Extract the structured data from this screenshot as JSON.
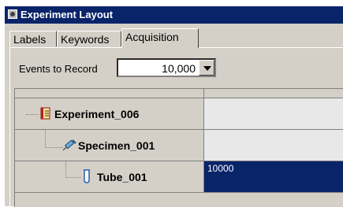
{
  "window": {
    "title": "Experiment Layout"
  },
  "tabs": [
    {
      "label": "Labels",
      "active": false
    },
    {
      "label": "Keywords",
      "active": false
    },
    {
      "label": "Acquisition",
      "active": true
    }
  ],
  "events": {
    "label": "Events to Record",
    "value": "10,000"
  },
  "tree": [
    {
      "name": "Experiment_006",
      "icon": "experiment-book-icon",
      "value": ""
    },
    {
      "name": "Specimen_001",
      "icon": "syringe-icon",
      "value": ""
    },
    {
      "name": "Tube_001",
      "icon": "tube-icon",
      "value": "10000",
      "selected": true
    }
  ],
  "colors": {
    "title_bar": "#0a246a",
    "selection": "#0a246a",
    "window_bg": "#d4d0c8"
  }
}
